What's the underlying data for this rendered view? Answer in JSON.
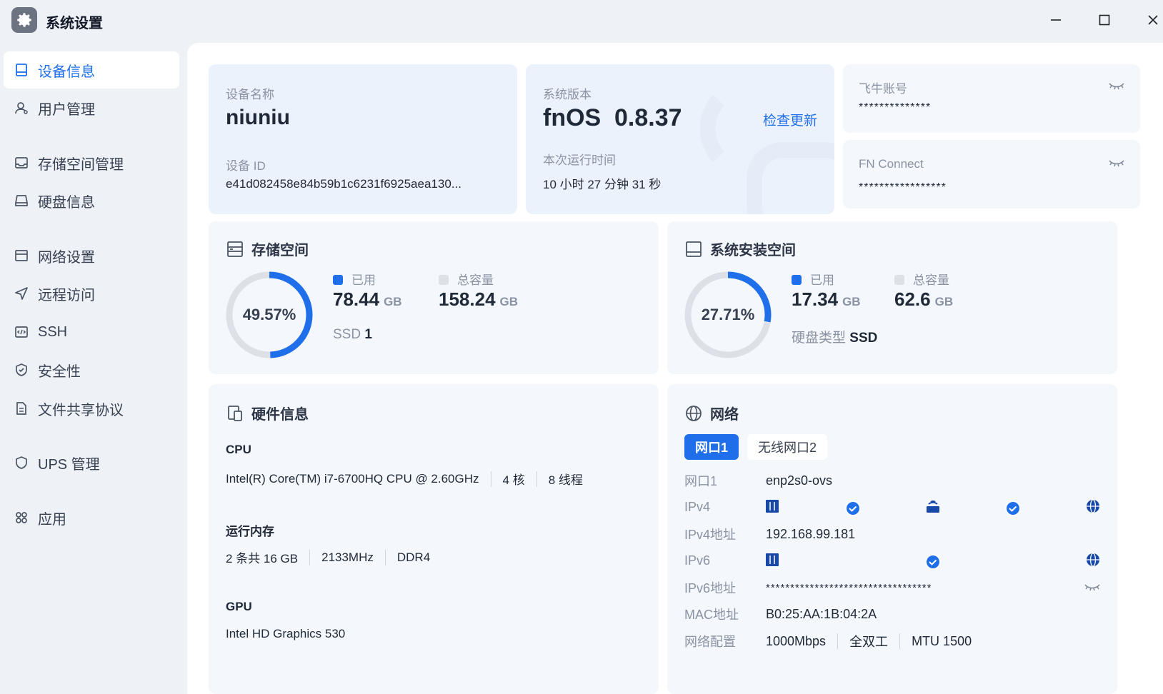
{
  "app": {
    "title": "系统设置"
  },
  "sidebar": {
    "items": [
      {
        "label": "设备信息",
        "icon": "device-icon",
        "active": true
      },
      {
        "label": "用户管理",
        "icon": "user-icon"
      },
      {
        "label": "存储空间管理",
        "icon": "storage-icon"
      },
      {
        "label": "硬盘信息",
        "icon": "disk-icon"
      },
      {
        "label": "网络设置",
        "icon": "network-icon"
      },
      {
        "label": "远程访问",
        "icon": "send-icon"
      },
      {
        "label": "SSH",
        "icon": "code-icon"
      },
      {
        "label": "安全性",
        "icon": "shield-check-icon"
      },
      {
        "label": "文件共享协议",
        "icon": "file-icon"
      },
      {
        "label": "UPS 管理",
        "icon": "shield-icon"
      },
      {
        "label": "应用",
        "icon": "apps-icon"
      }
    ]
  },
  "device": {
    "name_label": "设备名称",
    "name": "niuniu",
    "id_label": "设备 ID",
    "id": "e41d082458e84b59b1c6231f6925aea130..."
  },
  "system": {
    "version_label": "系统版本",
    "os": "fnOS",
    "version": "0.8.37",
    "check_update": "检查更新",
    "uptime_label": "本次运行时间",
    "uptime": "10 小时 27 分钟 31 秒"
  },
  "accounts": {
    "feiniu_label": "飞牛账号",
    "feiniu_value": "**************",
    "fnconnect_label": "FN Connect",
    "fnconnect_value": "*****************"
  },
  "storage": {
    "title": "存储空间",
    "percent": "49.57%",
    "percent_value": 49.57,
    "used_label": "已用",
    "used": "78.44",
    "used_unit": "GB",
    "total_label": "总容量",
    "total": "158.24",
    "total_unit": "GB",
    "type_label": "SSD",
    "type_value": "1"
  },
  "sysinstall": {
    "title": "系统安装空间",
    "percent": "27.71%",
    "percent_value": 27.71,
    "used_label": "已用",
    "used": "17.34",
    "used_unit": "GB",
    "total_label": "总容量",
    "total": "62.6",
    "total_unit": "GB",
    "type_label": "硬盘类型",
    "type_value": "SSD"
  },
  "hardware": {
    "title": "硬件信息",
    "cpu_label": "CPU",
    "cpu_model": "Intel(R) Core(TM) i7-6700HQ CPU @ 2.60GHz",
    "cpu_cores": "4 核",
    "cpu_threads": "8 线程",
    "mem_label": "运行内存",
    "mem_size": "2 条共 16 GB",
    "mem_speed": "2133MHz",
    "mem_type": "DDR4",
    "gpu_label": "GPU",
    "gpu_model": "Intel HD Graphics 530"
  },
  "network": {
    "title": "网络",
    "tabs": [
      "网口1",
      "无线网口2"
    ],
    "port_label": "网口1",
    "port_value": "enp2s0-ovs",
    "ipv4_label": "IPv4",
    "ipv4_addr_label": "IPv4地址",
    "ipv4_addr": "192.168.99.181",
    "ipv6_label": "IPv6",
    "ipv6_addr_label": "IPv6地址",
    "ipv6_addr": "**********************************",
    "mac_label": "MAC地址",
    "mac": "B0:25:AA:1B:04:2A",
    "config_label": "网络配置",
    "speed": "1000Mbps",
    "duplex": "全双工",
    "mtu": "MTU 1500"
  },
  "colors": {
    "accent": "#1f6feb",
    "ring_track": "#dde1e7",
    "card_bg": "#f4f7fb"
  }
}
